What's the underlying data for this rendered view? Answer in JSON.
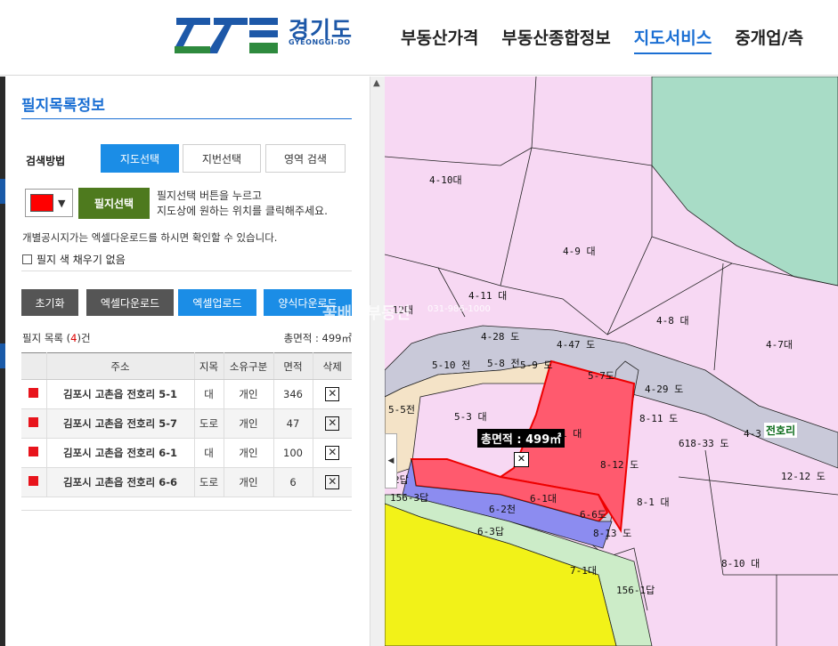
{
  "header": {
    "logo_text": "경기도",
    "logo_sub": "GYEONGGI-DO",
    "nav": [
      {
        "label": "부동산가격",
        "active": false
      },
      {
        "label": "부동산종합정보",
        "active": false
      },
      {
        "label": "지도서비스",
        "active": true
      },
      {
        "label": "중개업/측",
        "active": false
      }
    ]
  },
  "panel": {
    "title": "필지목록정보",
    "search_label": "검색방법",
    "tabs": [
      "지도선택",
      "지번선택",
      "영역 검색"
    ],
    "color": "#ff0000",
    "select_button": "필지선택",
    "guide_line1": "필지선택 버튼을 누르고",
    "guide_line2": "지도상에 원하는 위치를 클릭해주세요.",
    "note": "개별공시지가는 엑셀다운로드를 하시면 확인할 수 있습니다.",
    "checkbox_label": "필지 색 채우기 없음",
    "buttons": [
      "초기화",
      "엑셀다운로드",
      "엑셀업로드",
      "양식다운로드"
    ],
    "list_label_prefix": "필지 목록 (",
    "list_count": "4",
    "list_label_suffix": ")건",
    "total_area": "총면적 : 499㎡",
    "columns": [
      "주소",
      "지목",
      "소유구분",
      "면적",
      "삭제"
    ],
    "rows": [
      {
        "address": "김포시 고촌읍 전호리 5-1",
        "category": "대",
        "owner": "개인",
        "area": "346"
      },
      {
        "address": "김포시 고촌읍 전호리 5-7",
        "category": "도로",
        "owner": "개인",
        "area": "47"
      },
      {
        "address": "김포시 고촌읍 전호리 6-1",
        "category": "대",
        "owner": "개인",
        "area": "100"
      },
      {
        "address": "김포시 고촌읍 전호리 6-6",
        "category": "도로",
        "owner": "개인",
        "area": "6"
      }
    ],
    "delete_glyph": "✕"
  },
  "map": {
    "total_tag": "총면적 : 499㎡",
    "village": "전호리",
    "watermark": "꽃배달부동산",
    "watermark_phone": "031-986-1000",
    "parcels": [
      "4-10대",
      "4-9 대",
      "4-11 대",
      "-12대",
      "4-28 도",
      "4-47 도",
      "4-8 대",
      "4-7대",
      "5-10 전",
      "5-8 전",
      "5-9 도",
      "5-7도",
      "4-29 도",
      "5-5전",
      "5-3 대",
      "1 대",
      "8-11 도",
      "618-33 도",
      "4-3",
      "8-12 도",
      "12-12 도",
      "2답",
      "156-3답",
      "6-1대",
      "6-2천",
      "6-6도",
      "8-1 대",
      "6-3답",
      "8-13 도",
      "7-1대",
      "156-1답",
      "8-10 대"
    ],
    "colors": {
      "land": "#f7d8f3",
      "road": "#c9c9d9",
      "forest": "#a8dcc6",
      "paddy": "#f2f218",
      "field": "#f4e3c7",
      "selected_red": "#ff5a6e",
      "selected_blue": "#8c8cf0",
      "stream": "#ccecc8"
    }
  }
}
